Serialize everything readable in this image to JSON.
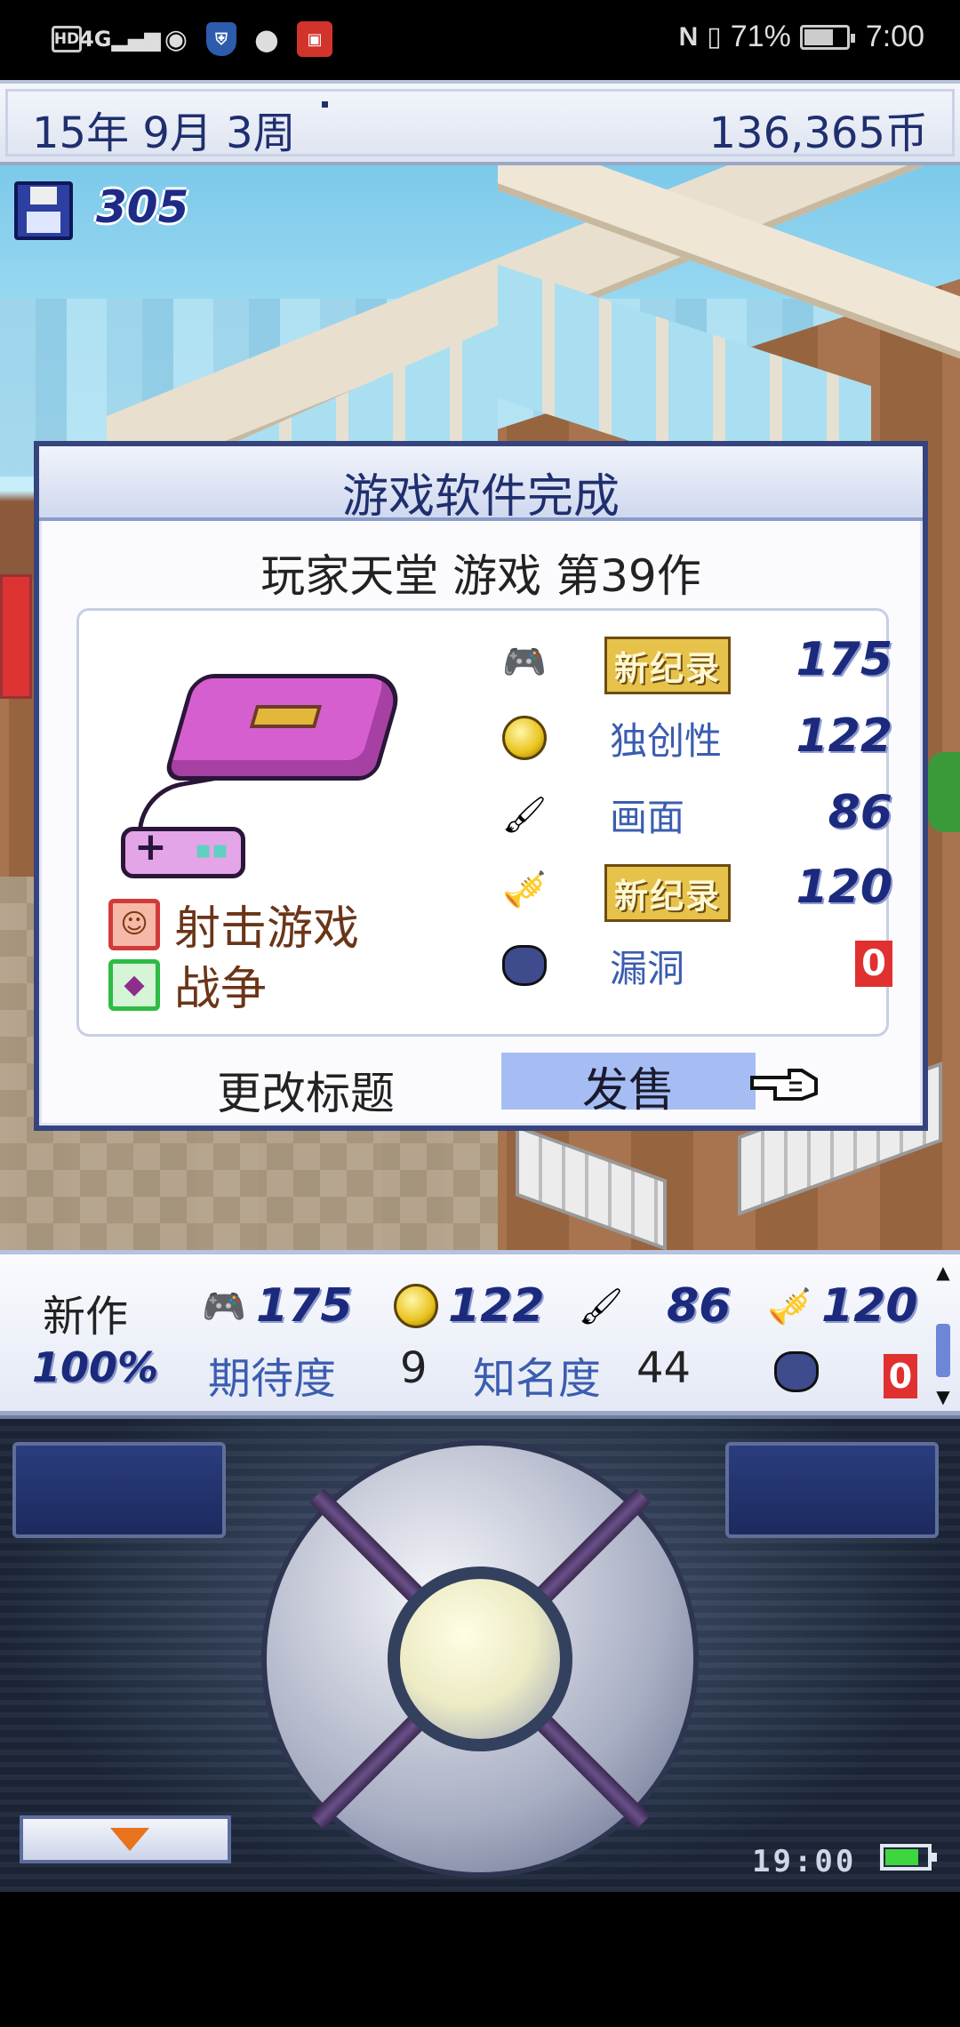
{
  "status_bar": {
    "hd": "HD",
    "network": "4G",
    "nfc": "N",
    "battery_text": "71%",
    "battery_level": 0.71,
    "time": "7:00"
  },
  "top_bar": {
    "date": "15年 9月 3周",
    "money": "136,365币"
  },
  "scene": {
    "save_count": "305"
  },
  "dialog": {
    "title": "游戏软件完成",
    "subtitle": "玩家天堂 游戏 第39作",
    "genres": [
      {
        "label": "射击游戏",
        "icon": "face-icon"
      },
      {
        "label": "战争",
        "icon": "gem-icon"
      }
    ],
    "stats": {
      "fun": {
        "badge": "新纪录",
        "value": "175",
        "icon": "gamepad-icon"
      },
      "creativity": {
        "name": "独创性",
        "value": "122",
        "icon": "bulb-icon"
      },
      "graphics": {
        "name": "画面",
        "value": "86",
        "icon": "paintbrush-icon"
      },
      "sound": {
        "badge": "新纪录",
        "value": "120",
        "icon": "trumpet-icon"
      },
      "bugs": {
        "name": "漏洞",
        "value": "0",
        "icon": "bug-icon"
      }
    },
    "buttons": {
      "rename": "更改标题",
      "sell": "发售"
    }
  },
  "info_bar": {
    "new_label": "新作",
    "completion": "100%",
    "fun": "175",
    "creativity": "122",
    "graphics": "86",
    "sound": "120",
    "expectation_label": "期待度",
    "expectation": "9",
    "fame_label": "知名度",
    "fame": "44",
    "bugs": "0"
  },
  "pad": {
    "clock": "19:00",
    "battery_level": 0.8
  },
  "colors": {
    "accent": "#1f2f6e",
    "record_gold": "#e6c24a",
    "bug_red": "#e03030",
    "sell_highlight": "#a6bdf4"
  }
}
